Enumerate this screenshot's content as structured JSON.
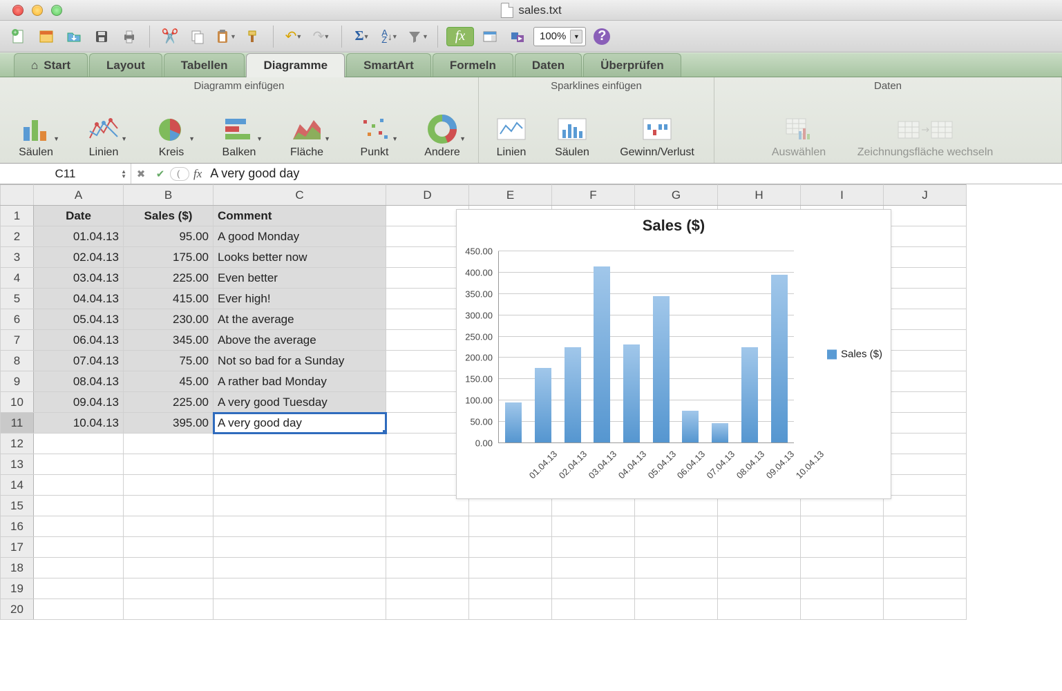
{
  "window": {
    "filename": "sales.txt"
  },
  "qat": {
    "zoom": "100%"
  },
  "tabs": [
    "Start",
    "Layout",
    "Tabellen",
    "Diagramme",
    "SmartArt",
    "Formeln",
    "Daten",
    "Überprüfen"
  ],
  "active_tab": "Diagramme",
  "ribbon": {
    "group_insert": "Diagramm einfügen",
    "group_sparklines": "Sparklines einfügen",
    "group_data": "Daten",
    "btn_columns": "Säulen",
    "btn_lines": "Linien",
    "btn_pie": "Kreis",
    "btn_bars": "Balken",
    "btn_area": "Fläche",
    "btn_scatter": "Punkt",
    "btn_other": "Andere",
    "btn_spark_lines": "Linien",
    "btn_spark_cols": "Säulen",
    "btn_spark_winloss": "Gewinn/Verlust",
    "btn_select": "Auswählen",
    "btn_switch": "Zeichnungsfläche wechseln"
  },
  "formula_bar": {
    "cell_ref": "C11",
    "value": "A very good day"
  },
  "columns": [
    "A",
    "B",
    "C",
    "D",
    "E",
    "F",
    "G",
    "H",
    "I",
    "J"
  ],
  "headers": {
    "date": "Date",
    "sales": "Sales ($)",
    "comment": "Comment"
  },
  "rows": [
    {
      "n": 1
    },
    {
      "n": 2,
      "date": "01.04.13",
      "sales": "95.00",
      "comment": "A good Monday"
    },
    {
      "n": 3,
      "date": "02.04.13",
      "sales": "175.00",
      "comment": "Looks better now"
    },
    {
      "n": 4,
      "date": "03.04.13",
      "sales": "225.00",
      "comment": "Even better"
    },
    {
      "n": 5,
      "date": "04.04.13",
      "sales": "415.00",
      "comment": "Ever high!"
    },
    {
      "n": 6,
      "date": "05.04.13",
      "sales": "230.00",
      "comment": "At the average"
    },
    {
      "n": 7,
      "date": "06.04.13",
      "sales": "345.00",
      "comment": "Above the average"
    },
    {
      "n": 8,
      "date": "07.04.13",
      "sales": "75.00",
      "comment": "Not so bad for a Sunday"
    },
    {
      "n": 9,
      "date": "08.04.13",
      "sales": "45.00",
      "comment": "A rather bad Monday"
    },
    {
      "n": 10,
      "date": "09.04.13",
      "sales": "225.00",
      "comment": "A very good Tuesday"
    },
    {
      "n": 11,
      "date": "10.04.13",
      "sales": "395.00",
      "comment": "A very good day"
    },
    {
      "n": 12
    },
    {
      "n": 13
    },
    {
      "n": 14
    },
    {
      "n": 15
    },
    {
      "n": 16
    },
    {
      "n": 17
    },
    {
      "n": 18
    },
    {
      "n": 19
    },
    {
      "n": 20
    }
  ],
  "chart_data": {
    "type": "bar",
    "title": "Sales ($)",
    "legend": "Sales ($)",
    "categories": [
      "01.04.13",
      "02.04.13",
      "03.04.13",
      "04.04.13",
      "05.04.13",
      "06.04.13",
      "07.04.13",
      "08.04.13",
      "09.04.13",
      "10.04.13"
    ],
    "values": [
      95,
      175,
      225,
      415,
      230,
      345,
      75,
      45,
      225,
      395
    ],
    "ylim": [
      0,
      450
    ],
    "yticks": [
      "0.00",
      "50.00",
      "100.00",
      "150.00",
      "200.00",
      "250.00",
      "300.00",
      "350.00",
      "400.00",
      "450.00"
    ],
    "xlabel": "",
    "ylabel": ""
  }
}
